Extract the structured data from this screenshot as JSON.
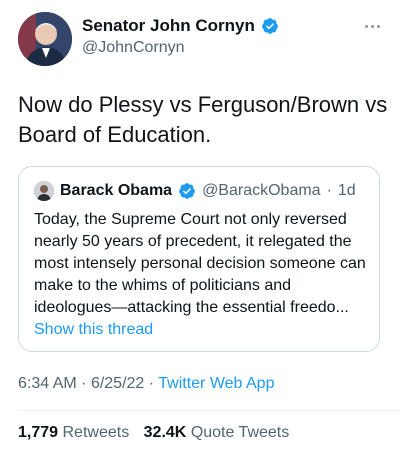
{
  "author": {
    "display_name": "Senator John Cornyn",
    "handle": "@JohnCornyn",
    "verified": true
  },
  "tweet": {
    "text": "Now do Plessy vs Ferguson/Brown vs Board of Education."
  },
  "quoted_tweet": {
    "display_name": "Barack Obama",
    "handle": "@BarackObama",
    "age": "1d",
    "text": "Today, the Supreme Court not only reversed nearly 50 years of precedent, it relegated the most intensely personal decision someone can make to the whims of politicians and ideologues—attacking the essential freedo...",
    "link_label": "Show this thread"
  },
  "meta": {
    "time": "6:34 AM",
    "date": "6/25/22",
    "source": "Twitter Web App"
  },
  "stats": {
    "retweets_count": "1,779",
    "retweets_label": "Retweets",
    "quotes_count": "32.4K",
    "quotes_label": "Quote Tweets"
  },
  "colors": {
    "accent": "#1d9bf0",
    "text_primary": "#0f1419",
    "text_secondary": "#536471",
    "border": "#cfd9de"
  },
  "icons": [
    "verified-badge-icon",
    "more-options-icon"
  ]
}
